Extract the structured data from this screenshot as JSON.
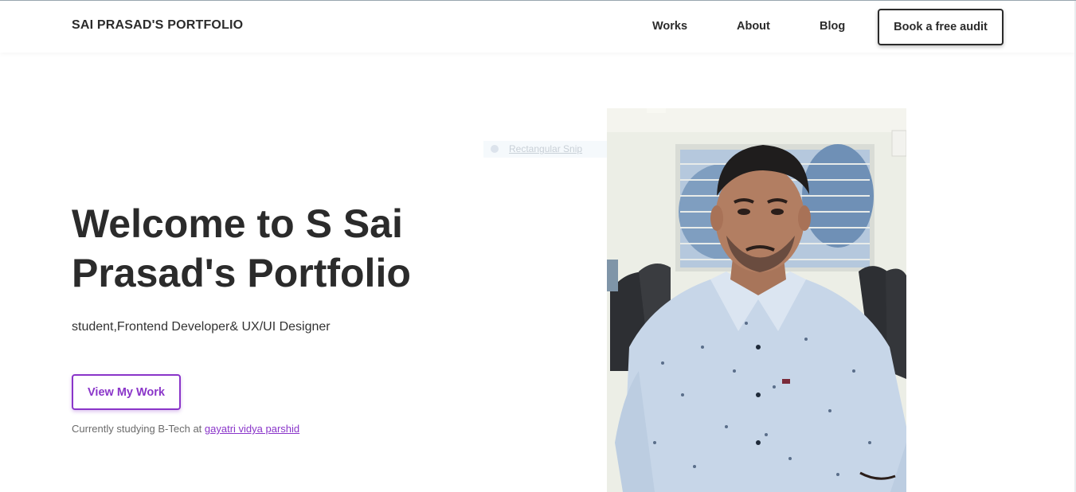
{
  "header": {
    "brand": "SAI PRASAD'S PORTFOLIO",
    "nav": [
      "Works",
      "About",
      "Blog"
    ],
    "cta": "Book a free audit"
  },
  "hero": {
    "title": "Welcome to S Sai Prasad's Portfolio",
    "subtitle": "student,Frontend Developer& UX/UI Designer",
    "button": "View My Work",
    "study_prefix": "Currently studying B-Tech at ",
    "study_link": "gayatri vidya parshid"
  },
  "overlay": {
    "snip_label": "Rectangular Snip"
  },
  "photo": {
    "icon": "profile-photo"
  },
  "colors": {
    "accent": "#8a35c9",
    "text": "#2b2b2b"
  }
}
